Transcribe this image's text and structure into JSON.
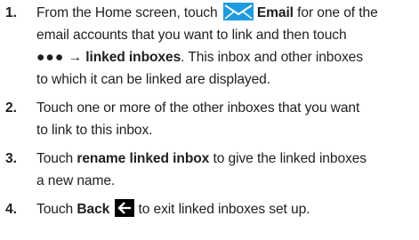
{
  "steps": [
    {
      "number": "1.",
      "line1_pre": "From the Home screen, touch",
      "line1_bold": "Email",
      "line1_post": "for one of the",
      "line2": "email accounts that you want to link and then touch",
      "line3_dots": "●●●",
      "line3_arrow": "→",
      "line3_bold": "linked inboxes",
      "line3_post": ". This inbox and other inboxes",
      "line4": "to which it can be linked are displayed.",
      "icon": "email-envelope-icon"
    },
    {
      "number": "2.",
      "line1": "Touch one or more of the other inboxes that you want",
      "line2": "to link to this inbox."
    },
    {
      "number": "3.",
      "line1_pre": "Touch",
      "line1_bold": "rename linked inbox",
      "line1_post": "to give the linked inboxes",
      "line2": "a new name."
    },
    {
      "number": "4.",
      "line1_pre": "Touch",
      "line1_bold": "Back",
      "line1_post": "to exit linked inboxes set up.",
      "icon": "back-arrow-icon"
    }
  ],
  "colors": {
    "text": "#1f1f1f",
    "email_icon": "#1e9be0",
    "back_icon": "#000000"
  }
}
